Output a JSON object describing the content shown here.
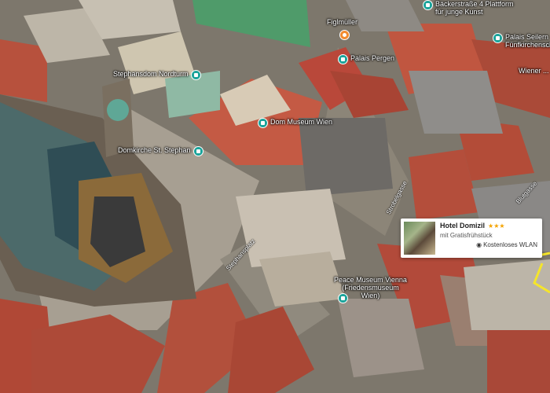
{
  "map": {
    "pois": [
      {
        "name": "Stephansdom Nordturm"
      },
      {
        "name": "Domkirche St. Stephan"
      },
      {
        "name": "Dom Museum Wien"
      },
      {
        "name": "Palais Pergen"
      },
      {
        "name": "Figlmüller"
      },
      {
        "name": "Bäckerstraße 4 Plattform für junge Kunst"
      },
      {
        "name": "Palais Seilern Fünfkirchensche..."
      },
      {
        "name": "Peace Museum Vienna (Friedensmuseum Wien)"
      },
      {
        "name": "Wiener ..."
      }
    ],
    "streets": [
      "Stephansplatz",
      "Strobelgasse",
      "Blutgasse"
    ],
    "hotel": {
      "name": "Hotel Domizil",
      "stars": "★★★",
      "breakfast": "mit Gratisfrühstück",
      "wifi": "Kostenloses WLAN"
    }
  },
  "colors": {
    "poi_teal": "#1aa39a",
    "poi_orange": "#f28b30",
    "stars": "#f4a300",
    "highlight": "#f5e52a"
  }
}
